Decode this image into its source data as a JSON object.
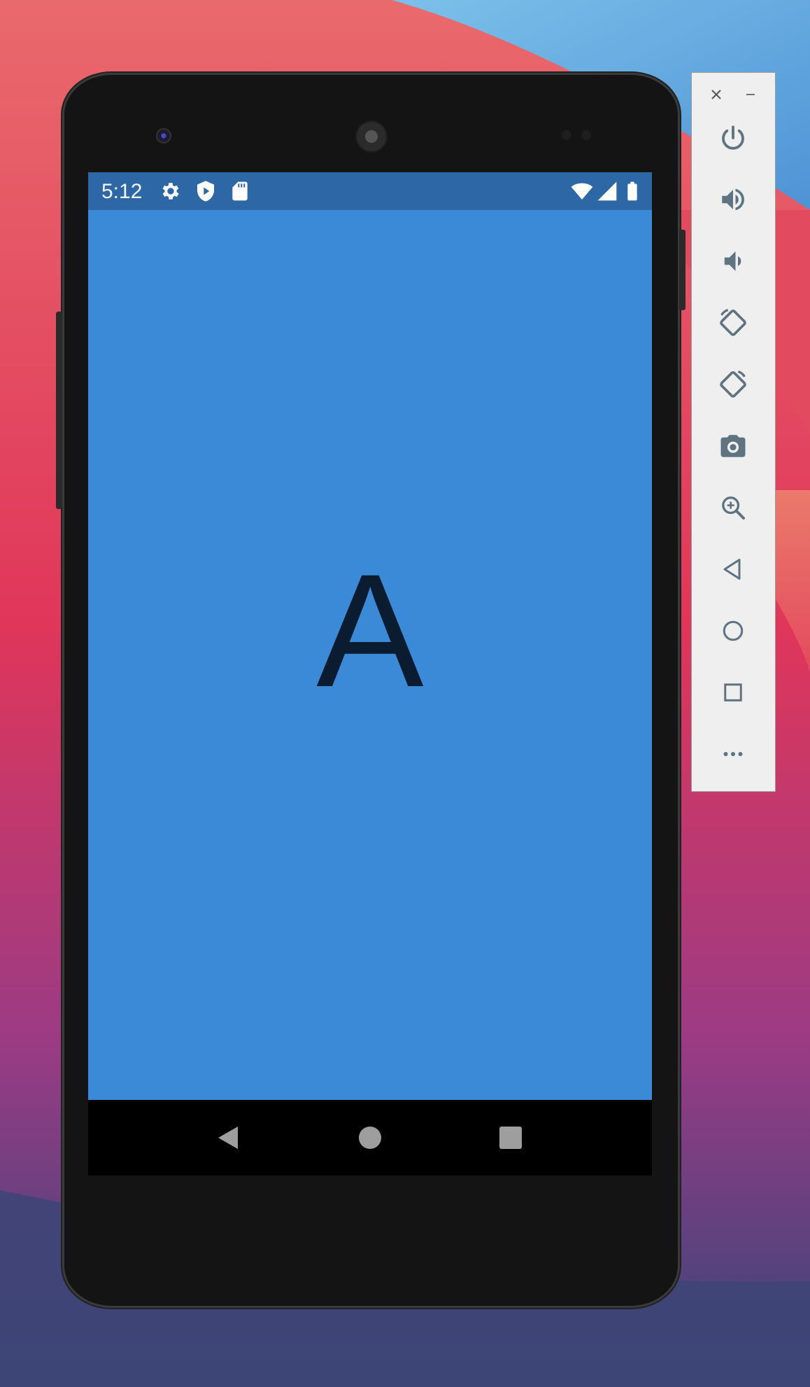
{
  "status_bar": {
    "time": "5:12",
    "icons": [
      "settings-icon",
      "play-protect-icon",
      "sd-card-icon",
      "wifi-icon",
      "cell-signal-icon",
      "battery-icon"
    ]
  },
  "app": {
    "letter": "A",
    "background_color": "#3b8ad8",
    "status_bar_color": "#2d67a6"
  },
  "nav_bar": {
    "buttons": [
      "back-icon",
      "home-icon",
      "recents-icon"
    ]
  },
  "emulator_toolbar": {
    "window_controls": [
      "close-icon",
      "minimize-icon"
    ],
    "buttons": [
      "power-icon",
      "volume-up-icon",
      "volume-down-icon",
      "rotate-left-icon",
      "rotate-right-icon",
      "camera-icon",
      "zoom-icon",
      "back-icon",
      "home-icon",
      "overview-icon",
      "more-icon"
    ],
    "icon_color": "#5f7380"
  }
}
